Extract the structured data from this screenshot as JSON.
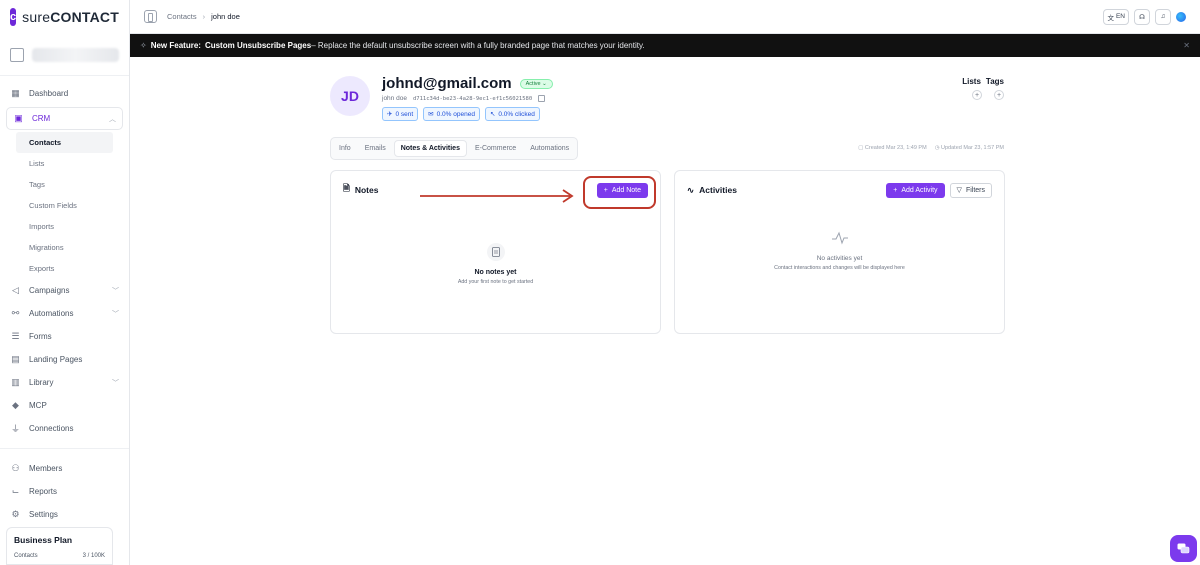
{
  "brand": {
    "logo_text_light": "sure",
    "logo_text_bold": "CONTACT"
  },
  "sidebar": {
    "items": [
      {
        "label": "Dashboard",
        "icon": "dashboard-icon"
      },
      {
        "label": "CRM",
        "icon": "crm-icon",
        "expanded": true
      },
      {
        "label": "Campaigns",
        "icon": "megaphone-icon"
      },
      {
        "label": "Automations",
        "icon": "automation-icon"
      },
      {
        "label": "Forms",
        "icon": "form-icon"
      },
      {
        "label": "Landing Pages",
        "icon": "layout-icon"
      },
      {
        "label": "Library",
        "icon": "library-icon"
      },
      {
        "label": "MCP",
        "icon": "mcp-icon"
      },
      {
        "label": "Connections",
        "icon": "plug-icon"
      },
      {
        "label": "Members",
        "icon": "users-icon"
      },
      {
        "label": "Reports",
        "icon": "chart-icon"
      },
      {
        "label": "Settings",
        "icon": "gear-icon"
      }
    ],
    "crm_sub": [
      "Contacts",
      "Lists",
      "Tags",
      "Custom Fields",
      "Imports",
      "Migrations",
      "Exports"
    ],
    "active_sub": "Contacts",
    "plan": {
      "title": "Business Plan",
      "contacts_label": "Contacts",
      "contacts_value": "3 / 100K"
    }
  },
  "topbar": {
    "breadcrumb": [
      "Contacts",
      "john doe"
    ],
    "lang": "EN"
  },
  "banner": {
    "prefix": "New Feature:",
    "feature": "Custom Unsubscribe Pages",
    "text": " – Replace the default unsubscribe screen with a fully branded page that matches your identity."
  },
  "contact": {
    "initials": "JD",
    "email": "johnd@gmail.com",
    "status": "Active ⌄",
    "name": "john doe",
    "uuid": "d711c34d-be23-4a28-9ec1-ef1c56021580",
    "stats": {
      "sent": "0 sent",
      "opened": "0.0% opened",
      "clicked": "0.0% clicked"
    },
    "lists_label": "Lists",
    "tags_label": "Tags",
    "created": "Created Mar 23, 1:49 PM",
    "updated": "Updated Mar 23, 1:57 PM"
  },
  "tabs": [
    "Info",
    "Emails",
    "Notes & Activities",
    "E-Commerce",
    "Automations"
  ],
  "active_tab": "Notes & Activities",
  "notes": {
    "title": "Notes",
    "add_button": "Add Note",
    "empty_title": "No notes yet",
    "empty_sub": "Add your first note to get started"
  },
  "activities": {
    "title": "Activities",
    "add_button": "Add Activity",
    "filters_button": "Filters",
    "empty_title": "No activities yet",
    "empty_sub": "Contact interactions and changes will be displayed here"
  },
  "colors": {
    "accent": "#7c3aed",
    "annotation": "#c0392b",
    "banner_bg": "#111111"
  }
}
